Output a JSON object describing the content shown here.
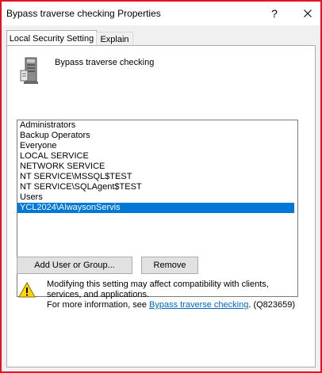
{
  "window": {
    "title": "Bypass traverse checking Properties",
    "help_glyph": "?",
    "close_glyph": "×"
  },
  "tabs": [
    {
      "label": "Local Security Setting",
      "active": true
    },
    {
      "label": "Explain",
      "active": false
    }
  ],
  "policy": {
    "name": "Bypass traverse checking",
    "icon": "server-policy-icon"
  },
  "accounts": {
    "items": [
      "Administrators",
      "Backup Operators",
      "Everyone",
      "LOCAL SERVICE",
      "NETWORK SERVICE",
      "NT SERVICE\\MSSQL$TEST",
      "NT SERVICE\\SQLAgent$TEST",
      "Users",
      "YCL2024\\AlwaysonServis"
    ],
    "selected": "YCL2024\\AlwaysonServis"
  },
  "buttons": {
    "add_label": "Add User or Group...",
    "remove_label": "Remove"
  },
  "warning": {
    "line1": "Modifying this setting may affect compatibility with clients, services, and applications.",
    "more_prefix": "For more information, see ",
    "link_text": "Bypass traverse checking",
    "more_suffix": ". (Q823659)"
  },
  "colors": {
    "window_border": "#e81123",
    "selection": "#0078d7",
    "link": "#0066cc"
  }
}
